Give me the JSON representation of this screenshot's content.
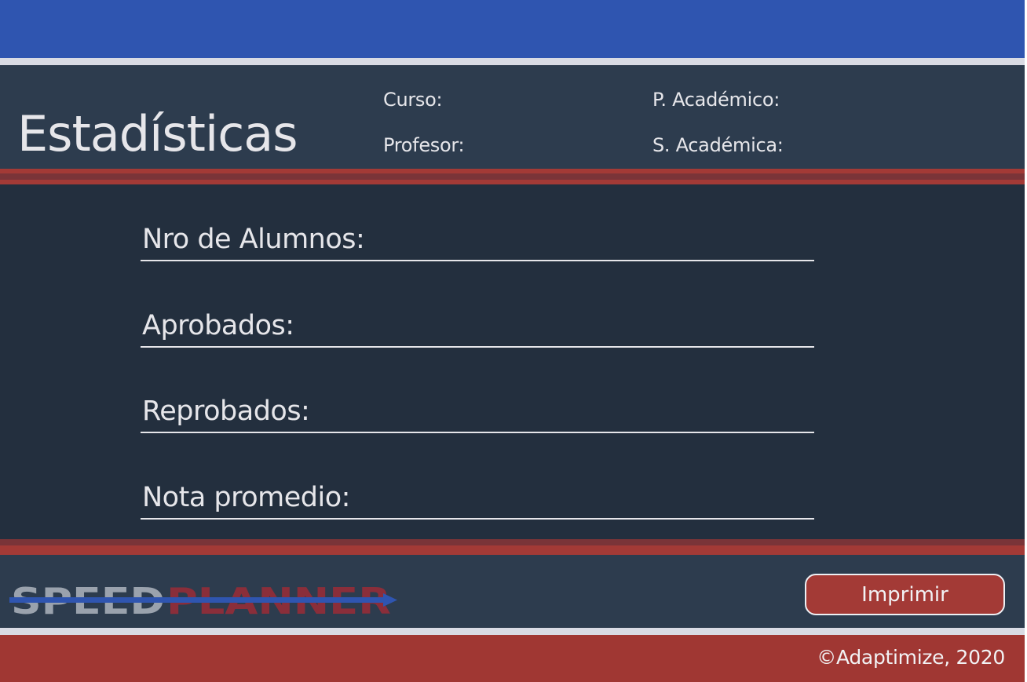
{
  "header": {
    "title": "Estadísticas",
    "curso_label": "Curso:",
    "profesor_label": "Profesor:",
    "periodo_label": "P. Académico:",
    "seccion_label": "S. Académica:"
  },
  "stats": {
    "alumnos_label": "Nro de Alumnos:",
    "aprobados_label": "Aprobados:",
    "reprobados_label": "Reprobados:",
    "promedio_label": "Nota promedio:"
  },
  "footer": {
    "logo_text_left": "SPEED",
    "logo_text_right": "PLANNER",
    "print_label": "Imprimir",
    "copyright": "©Adaptimize, 2020"
  },
  "colors": {
    "top_bar": "#2f55b0",
    "header_bg": "#2d3c4e",
    "main_bg": "#232f3e",
    "accent_red": "#a33a36",
    "text": "#e6e6ea"
  }
}
